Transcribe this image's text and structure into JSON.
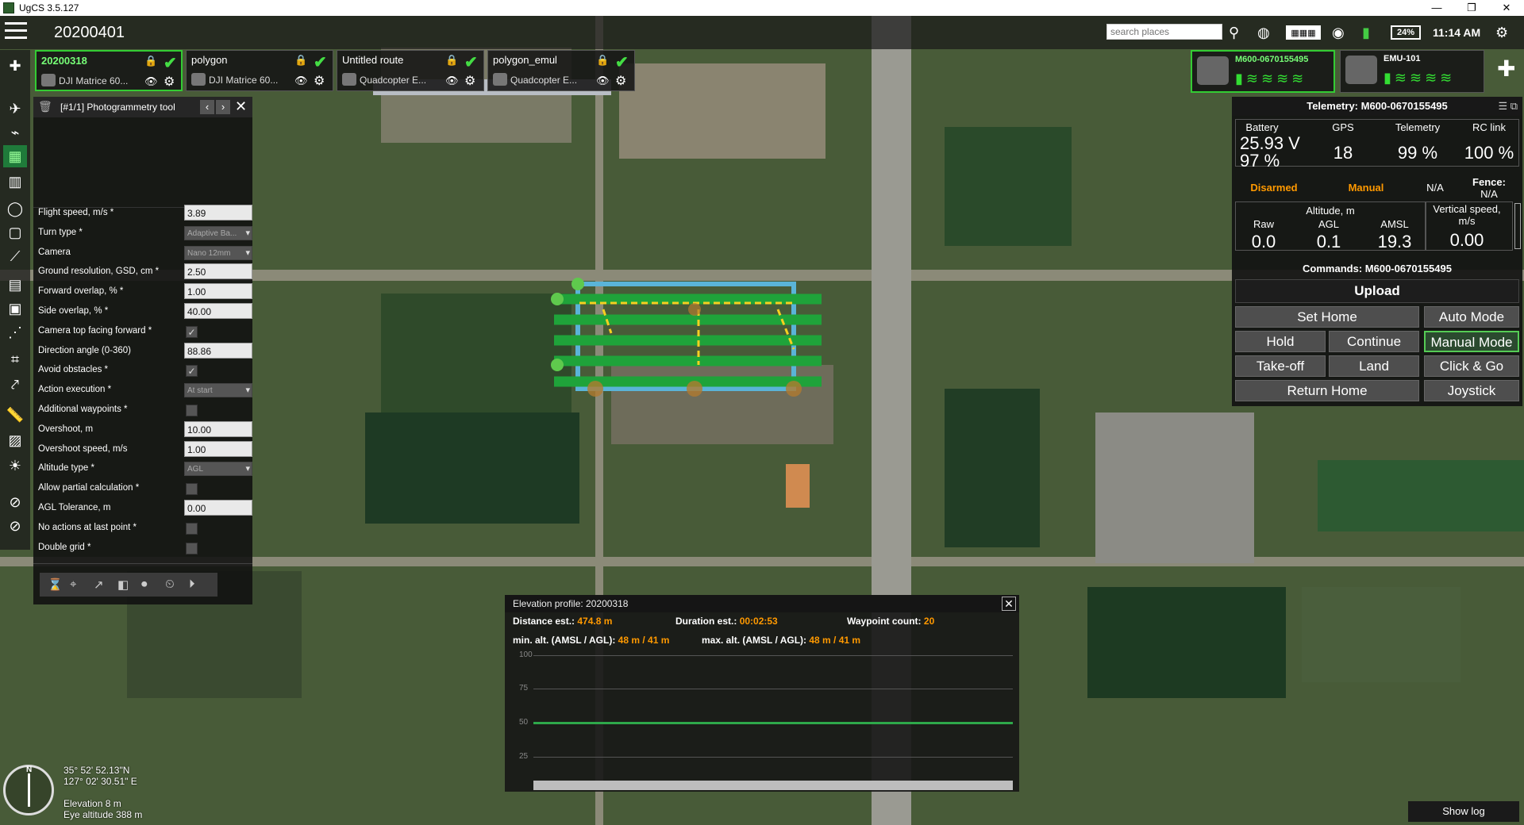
{
  "window": {
    "title": "UgCS 3.5.127",
    "minimize": "—",
    "restore": "❐",
    "close": "✕"
  },
  "topbar": {
    "mission": "20200401",
    "search_placeholder": "search places",
    "battery_pct": "24%",
    "time": "11:14 AM",
    "icons": [
      "search-icon",
      "globe-icon",
      "keyboard-icon",
      "adsb-icon",
      "battery-icon",
      "settings-icon"
    ]
  },
  "routes": [
    {
      "name": "20200318",
      "vehicle": "DJI Matrice 60...",
      "active": true
    },
    {
      "name": "polygon",
      "vehicle": "DJI Matrice 60...",
      "active": false
    },
    {
      "name": "Untitled route",
      "vehicle": "Quadcopter E...",
      "active": false
    },
    {
      "name": "polygon_emul",
      "vehicle": "Quadcopter E...",
      "active": false
    }
  ],
  "vehicles": [
    {
      "name": "M600-0670155495",
      "active": true
    },
    {
      "name": "EMU-101",
      "active": false
    }
  ],
  "photogrammetry": {
    "title": "[#1/1] Photogrammetry tool",
    "rows": [
      {
        "label": "Flight speed, m/s *",
        "type": "input",
        "value": "3.89"
      },
      {
        "label": "Turn type *",
        "type": "select",
        "value": "Adaptive Ba..."
      },
      {
        "label": "Camera",
        "type": "select",
        "value": "Nano 12mm"
      },
      {
        "label": "Ground resolution, GSD, cm *",
        "type": "input",
        "value": "2.50"
      },
      {
        "label": "Forward overlap, % *",
        "type": "input",
        "value": "1.00"
      },
      {
        "label": "Side overlap, % *",
        "type": "input",
        "value": "40.00"
      },
      {
        "label": "Camera top facing forward *",
        "type": "check",
        "value": "✓"
      },
      {
        "label": "Direction angle (0-360)",
        "type": "input",
        "value": "88.86"
      },
      {
        "label": "Avoid obstacles *",
        "type": "check",
        "value": "✓"
      },
      {
        "label": "Action execution *",
        "type": "select",
        "value": "At start"
      },
      {
        "label": "Additional waypoints *",
        "type": "check",
        "value": ""
      },
      {
        "label": "Overshoot, m",
        "type": "input",
        "value": "10.00"
      },
      {
        "label": "Overshoot speed, m/s",
        "type": "input",
        "value": "1.00"
      },
      {
        "label": "Altitude type *",
        "type": "select",
        "value": "AGL"
      },
      {
        "label": "Allow partial calculation *",
        "type": "check",
        "value": ""
      },
      {
        "label": "AGL Tolerance, m",
        "type": "input",
        "value": "0.00"
      },
      {
        "label": "No actions at last point *",
        "type": "check",
        "value": ""
      },
      {
        "label": "Double grid *",
        "type": "check",
        "value": ""
      }
    ]
  },
  "telemetry": {
    "title": "Telemetry: M600-0670155495",
    "battery_label": "Battery",
    "battery_v": "25.93 V",
    "battery_pct": "97 %",
    "gps_label": "GPS",
    "gps": "18",
    "telemetry_label": "Telemetry",
    "telemetry": "99 %",
    "rc_label": "RC link",
    "rc": "100 %",
    "armed": "Disarmed",
    "mode": "Manual",
    "na": "N/A",
    "fence_label": "Fence:",
    "fence": "N/A",
    "altitude_label": "Altitude, m",
    "raw_label": "Raw",
    "raw": "0.0",
    "agl_label": "AGL",
    "agl": "0.1",
    "amsl_label": "AMSL",
    "amsl": "19.3",
    "vspeed_label": "Vertical speed, m/s",
    "vspeed": "0.00"
  },
  "commands": {
    "title": "Commands: M600-0670155495",
    "upload": "Upload",
    "set_home": "Set Home",
    "auto_mode": "Auto Mode",
    "hold": "Hold",
    "continue": "Continue",
    "manual_mode": "Manual Mode",
    "takeoff": "Take-off",
    "land": "Land",
    "click_go": "Click & Go",
    "return_home": "Return Home",
    "joystick": "Joystick"
  },
  "elevation": {
    "title": "Elevation profile: 20200318",
    "distance_label": "Distance est.:",
    "distance": "474.8 m",
    "duration_label": "Duration est.:",
    "duration": "00:02:53",
    "wpcount_label": "Waypoint count:",
    "wpcount": "20",
    "minalt_label": "min. alt. (AMSL / AGL):",
    "minalt": "48 m / 41 m",
    "maxalt_label": "max. alt. (AMSL / AGL):",
    "maxalt": "48 m / 41 m",
    "yticks": [
      "100",
      "75",
      "50",
      "25"
    ],
    "route_altitude": 50
  },
  "position": {
    "lat": "35° 52' 52.13\"N",
    "lon": "127° 02' 30.51\" E",
    "elevation": "Elevation 8 m",
    "eye": "Eye altitude 388 m"
  },
  "show_log": "Show log"
}
